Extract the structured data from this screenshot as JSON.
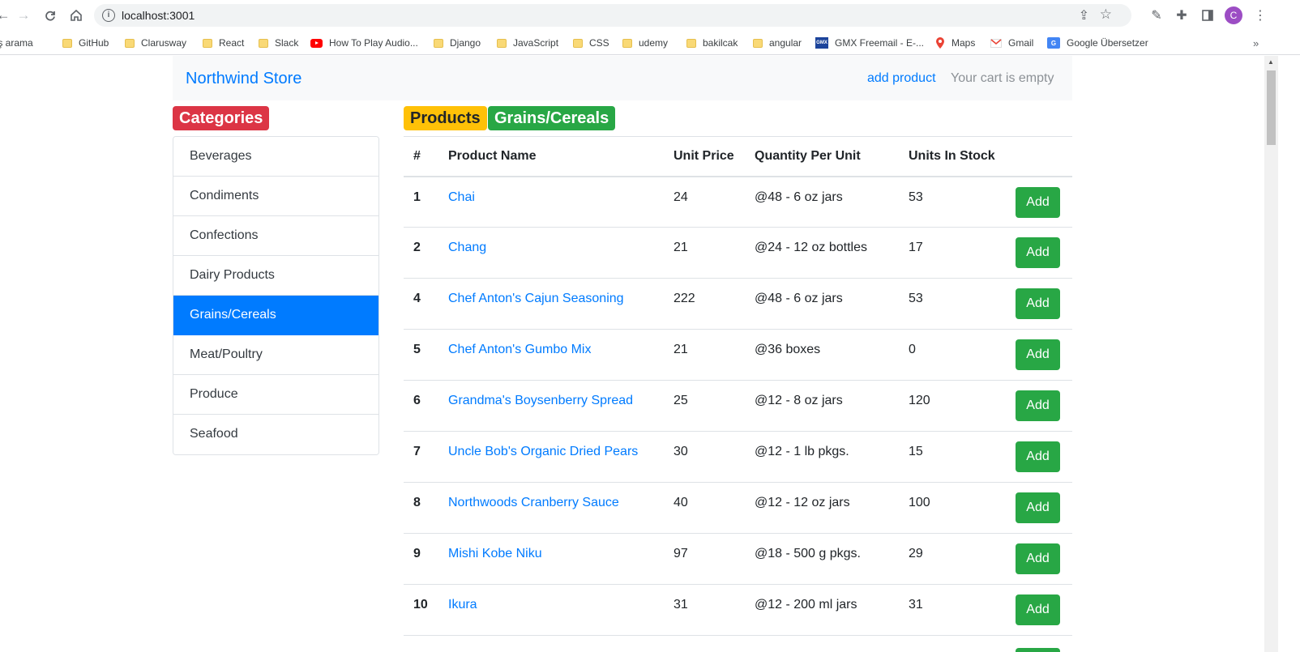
{
  "browser": {
    "url": "localhost:3001",
    "avatar_letter": "C",
    "bookmarks": [
      {
        "label": "İş arama",
        "icon": "folder-icon"
      },
      {
        "label": "GitHub",
        "icon": "folder-icon"
      },
      {
        "label": "Clarusway",
        "icon": "folder-icon"
      },
      {
        "label": "React",
        "icon": "folder-icon"
      },
      {
        "label": "Slack",
        "icon": "folder-icon"
      },
      {
        "label": "How To Play Audio...",
        "icon": "youtube-icon"
      },
      {
        "label": "Django",
        "icon": "folder-icon"
      },
      {
        "label": "JavaScript",
        "icon": "folder-icon"
      },
      {
        "label": "CSS",
        "icon": "folder-icon"
      },
      {
        "label": "udemy",
        "icon": "folder-icon"
      },
      {
        "label": "bakilcak",
        "icon": "folder-icon"
      },
      {
        "label": "angular",
        "icon": "folder-icon"
      },
      {
        "label": "GMX Freemail - E-...",
        "icon": "gmx-icon"
      },
      {
        "label": "Maps",
        "icon": "maps-icon"
      },
      {
        "label": "Gmail",
        "icon": "gmail-icon"
      },
      {
        "label": "Google Übersetzer",
        "icon": "translate-icon"
      }
    ],
    "more_label": "»"
  },
  "navbar": {
    "brand": "Northwind Store",
    "add_product": "add product",
    "cart": "Your cart is empty"
  },
  "categories": {
    "title": "Categories",
    "items": [
      "Beverages",
      "Condiments",
      "Confections",
      "Dairy Products",
      "Grains/Cereals",
      "Meat/Poultry",
      "Produce",
      "Seafood"
    ],
    "active": "Grains/Cereals"
  },
  "products": {
    "title": "Products",
    "current_category": "Grains/Cereals",
    "columns": [
      "#",
      "Product Name",
      "Unit Price",
      "Quantity Per Unit",
      "Units In Stock"
    ],
    "add_label": "Add",
    "rows": [
      {
        "id": "1",
        "name": "Chai",
        "price": "24",
        "qty": "@48 - 6 oz jars",
        "stock": "53"
      },
      {
        "id": "2",
        "name": "Chang",
        "price": "21",
        "qty": "@24 - 12 oz bottles",
        "stock": "17"
      },
      {
        "id": "4",
        "name": "Chef Anton's Cajun Seasoning",
        "price": "222",
        "qty": "@48 - 6 oz jars",
        "stock": "53"
      },
      {
        "id": "5",
        "name": "Chef Anton's Gumbo Mix",
        "price": "21",
        "qty": "@36 boxes",
        "stock": "0"
      },
      {
        "id": "6",
        "name": "Grandma's Boysenberry Spread",
        "price": "25",
        "qty": "@12 - 8 oz jars",
        "stock": "120"
      },
      {
        "id": "7",
        "name": "Uncle Bob's Organic Dried Pears",
        "price": "30",
        "qty": "@12 - 1 lb pkgs.",
        "stock": "15"
      },
      {
        "id": "8",
        "name": "Northwoods Cranberry Sauce",
        "price": "40",
        "qty": "@12 - 12 oz jars",
        "stock": "100"
      },
      {
        "id": "9",
        "name": "Mishi Kobe Niku",
        "price": "97",
        "qty": "@18 - 500 g pkgs.",
        "stock": "29"
      },
      {
        "id": "10",
        "name": "Ikura",
        "price": "31",
        "qty": "@12 - 200 ml jars",
        "stock": "31"
      }
    ]
  }
}
